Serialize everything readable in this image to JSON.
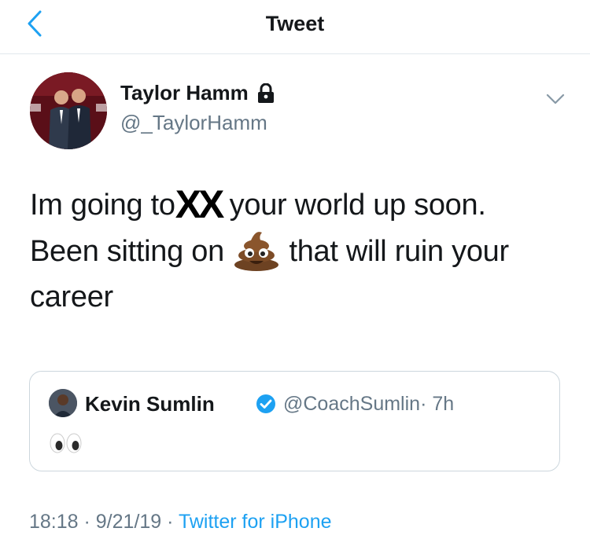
{
  "header": {
    "title": "Tweet"
  },
  "tweet": {
    "display_name": "Taylor Hamm",
    "handle": "@_TaylorHamm",
    "text_line1_start": "Im going to",
    "censor_mark": "XX",
    "text_line1_end": "your world up soon.",
    "text_line2_start": "Been sitting on",
    "text_line2_end": "that will ruin your",
    "text_line3": "career"
  },
  "quoted_tweet": {
    "display_name": "Kevin Sumlin",
    "handle": "@CoachSumlin",
    "time": "· 7h"
  },
  "meta": {
    "time": "18:18",
    "sep1": " · ",
    "date": "9/21/19",
    "sep2": " · ",
    "source": "Twitter for iPhone"
  },
  "icons": {
    "back": "chevron-left-icon",
    "lock": "lock-icon",
    "caret": "chevron-down-icon",
    "verified": "verified-badge-icon",
    "eyes": "eyes-emoji",
    "poop": "poop-emoji"
  },
  "colors": {
    "accent": "#1da1f2",
    "text": "#14171a",
    "secondary": "#657786",
    "border": "#e1e8ed"
  }
}
